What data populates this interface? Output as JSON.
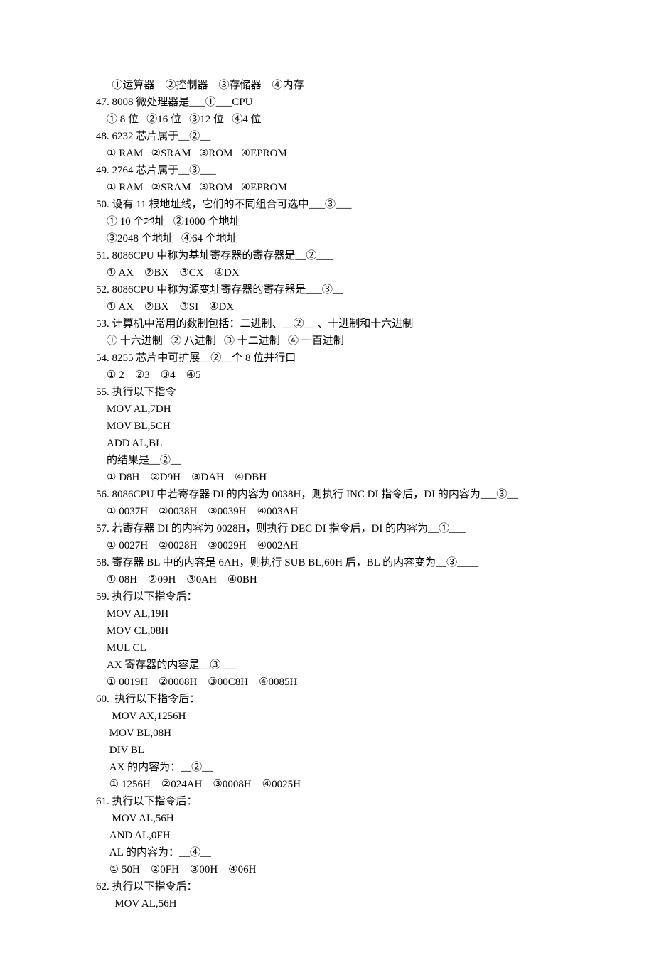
{
  "lines": [
    "      ①运算器    ②控制器    ③存储器    ④内存",
    "47. 8008 微处理器是___①___CPU",
    "    ① 8 位   ②16 位   ③12 位   ④4 位",
    "48. 6232 芯片属于__②__",
    "    ① RAM   ②SRAM   ③ROM   ④EPROM",
    "49. 2764 芯片属于__③___",
    "    ① RAM   ②SRAM   ③ROM   ④EPROM",
    "50. 设有 11 根地址线，它们的不同组合可选中___③___",
    "    ① 10 个地址   ②1000 个地址",
    "    ③2048 个地址   ④64 个地址",
    "51. 8086CPU 中称为基址寄存器的寄存器是__②___",
    "    ① AX    ②BX    ③CX    ④DX",
    "52. 8086CPU 中称为源变址寄存器的寄存器是___③__",
    "    ① AX    ②BX    ③SI    ④DX",
    "53. 计算机中常用的数制包括：二进制、__②__ 、十进制和十六进制",
    "    ① 十六进制   ② 八进制   ③ 十二进制   ④ 一百进制",
    "54. 8255 芯片中可扩展__②__个 8 位并行口",
    "    ① 2    ②3    ③4    ④5",
    "55. 执行以下指令",
    "    MOV AL,7DH",
    "    MOV BL,5CH",
    "    ADD AL,BL",
    "    的结果是__②__",
    "    ① D8H    ②D9H    ③DAH    ④DBH",
    "56. 8086CPU 中若寄存器 DI 的内容为 0038H，则执行 INC DI 指令后，DI 的内容为___③__",
    "    ① 0037H    ②0038H    ③0039H    ④003AH",
    "57. 若寄存器 DI 的内容为 0028H，则执行 DEC DI 指令后，DI 的内容为__①___",
    "    ① 0027H    ②0028H    ③0029H    ④002AH",
    "58. 寄存器 BL 中的内容是 6AH，则执行 SUB BL,60H 后，BL 的内容变为__③____",
    "    ① 08H    ②09H    ③0AH    ④0BH",
    "59. 执行以下指令后：",
    "    MOV AL,19H",
    "    MOV CL,08H",
    "    MUL CL",
    "    AX 寄存器的内容是__③___",
    "    ① 0019H    ②0008H    ③00C8H    ④0085H",
    "60.  执行以下指令后：",
    "      MOV AX,1256H",
    "     MOV BL,08H",
    "     DIV BL",
    "     AX 的内容为：__②__",
    "     ① 1256H    ②024AH    ③0008H    ④0025H",
    "61. 执行以下指令后：",
    "      MOV AL,56H",
    "     AND AL,0FH",
    "     AL 的内容为：__④__",
    "     ① 50H    ②0FH    ③00H    ④06H",
    "62. 执行以下指令后：",
    "       MOV AL,56H"
  ]
}
